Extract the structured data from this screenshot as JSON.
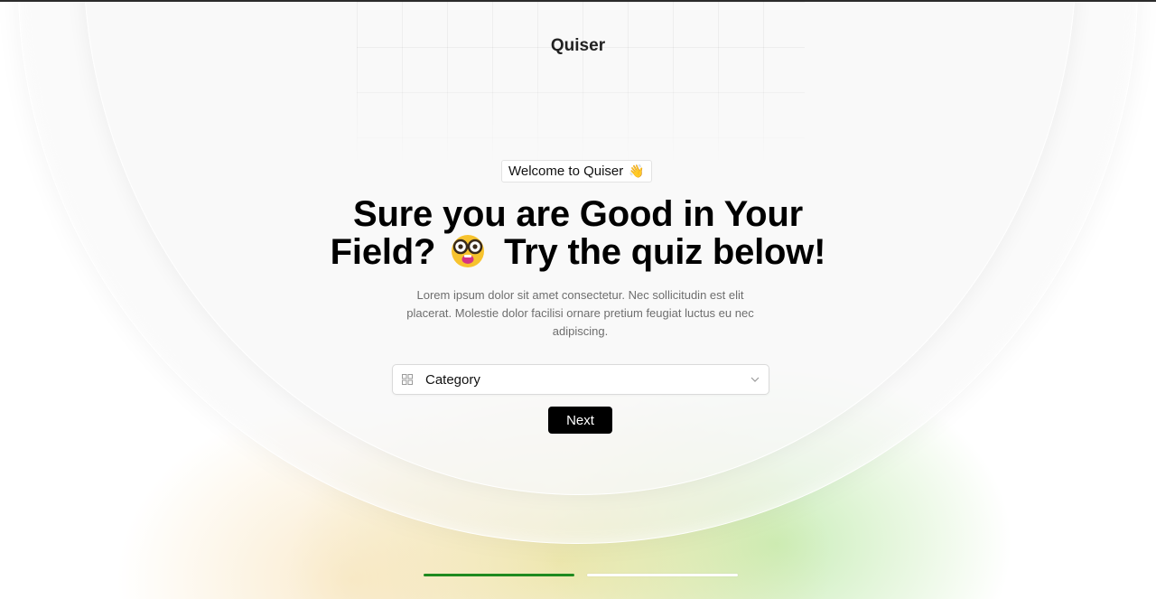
{
  "brand": "Quiser",
  "badge": {
    "text": "Welcome to Quiser",
    "emoji": "👋"
  },
  "headline": {
    "line1": "Sure you are Good in Your",
    "line2_start": "Field?",
    "line2_end": "Try the quiz below!",
    "emoji_icon": "nerd-face-icon"
  },
  "description": "Lorem ipsum dolor sit amet consectetur. Nec sollicitudin est elit placerat. Molestie dolor facilisi ornare pretium feugiat luctus eu nec adipiscing.",
  "category_select": {
    "value": "Category",
    "icon": "grid-icon",
    "chevron": "chevron-down-icon"
  },
  "next_button": "Next",
  "progress": {
    "total_steps": 2,
    "current_step": 1,
    "active_color": "#1f8a1f",
    "inactive_color": "#ffffff"
  },
  "colors": {
    "button_bg": "#000000",
    "text_primary": "#000000",
    "text_muted": "#6e6e6e"
  }
}
